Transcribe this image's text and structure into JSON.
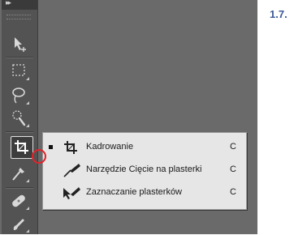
{
  "section_number": "1.7.",
  "toolbar": {
    "tools": [
      {
        "name": "move-tool",
        "icon": "move-arrow-icon"
      },
      {
        "name": "rectangular-marquee-tool",
        "icon": "marquee-icon"
      },
      {
        "name": "lasso-tool",
        "icon": "lasso-icon"
      },
      {
        "name": "quick-selection-tool",
        "icon": "quick-selection-icon"
      },
      {
        "name": "crop-tool",
        "icon": "crop-icon",
        "active": true
      },
      {
        "name": "eyedropper-tool",
        "icon": "eyedropper-icon"
      },
      {
        "name": "healing-brush-tool",
        "icon": "bandage-icon"
      },
      {
        "name": "brush-tool",
        "icon": "brush-icon"
      }
    ]
  },
  "flyout": {
    "items": [
      {
        "label": "Kadrowanie",
        "shortcut": "C",
        "selected": true,
        "icon": "crop-icon"
      },
      {
        "label": "Narzędzie Cięcie na plasterki",
        "shortcut": "C",
        "selected": false,
        "icon": "slice-knife-icon"
      },
      {
        "label": "Zaznaczanie plasterków",
        "shortcut": "C",
        "selected": false,
        "icon": "slice-select-icon"
      }
    ]
  },
  "colors": {
    "canvas": "#6a6a6a",
    "toolbar": "#535353",
    "flyout_bg": "#e6e6e6",
    "highlight": "#e0232a",
    "section_blue": "#3b5a97"
  }
}
